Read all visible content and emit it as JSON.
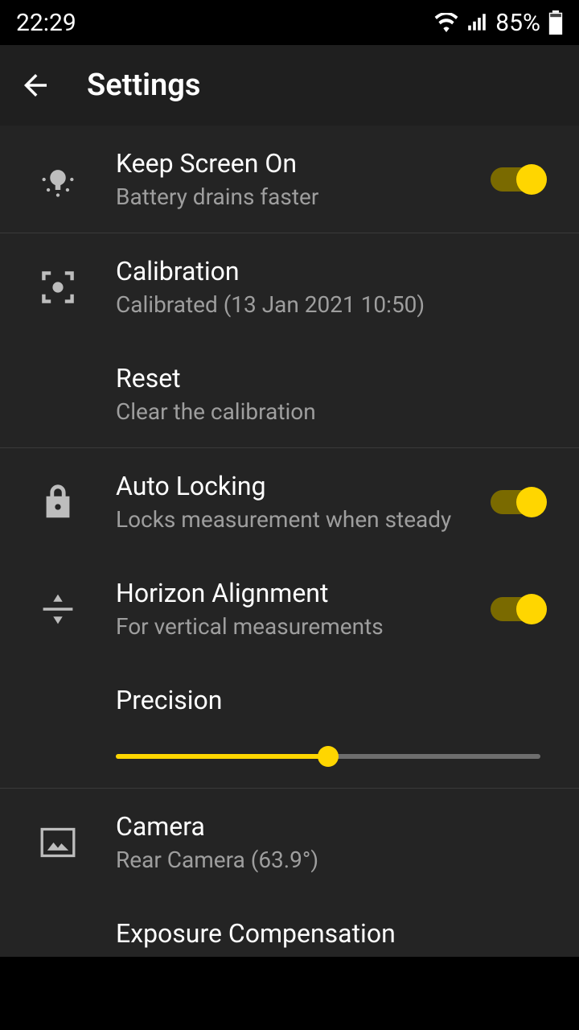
{
  "status": {
    "time": "22:29",
    "battery": "85%"
  },
  "appbar": {
    "title": "Settings"
  },
  "rows": {
    "keep_screen": {
      "title": "Keep Screen On",
      "sub": "Battery drains faster"
    },
    "calibration": {
      "title": "Calibration",
      "sub": "Calibrated (13 Jan 2021 10:50)"
    },
    "reset": {
      "title": "Reset",
      "sub": "Clear the calibration"
    },
    "auto_lock": {
      "title": "Auto Locking",
      "sub": "Locks measurement when steady"
    },
    "horizon": {
      "title": "Horizon Alignment",
      "sub": "For vertical measurements"
    },
    "precision": {
      "title": "Precision",
      "percent": 50
    },
    "camera": {
      "title": "Camera",
      "sub": "Rear Camera (63.9°)"
    },
    "exposure": {
      "title": "Exposure Compensation"
    }
  }
}
